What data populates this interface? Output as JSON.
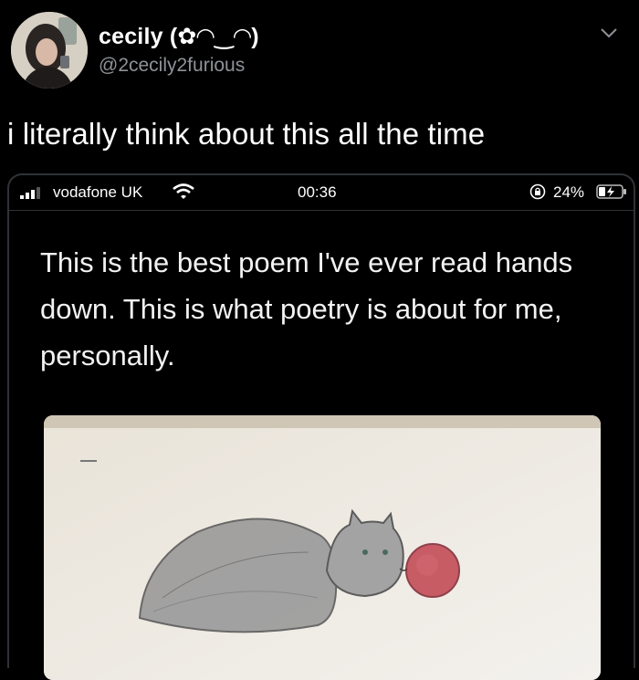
{
  "tweet": {
    "display_name": "cecily (✿◠‿◠)",
    "handle": "@2cecily2furious",
    "text": "i literally think about this all the time"
  },
  "screenshot": {
    "status_bar": {
      "carrier": "vodafone UK",
      "time": "00:36",
      "battery": "24%"
    },
    "post_text": "This is the best poem I've ever read hands down. This is what poetry is about for me, personally."
  },
  "icons": {
    "chevron": "chevron-down-icon",
    "signal": "signal-bars-icon",
    "wifi": "wifi-icon",
    "orientation_lock": "orientation-lock-icon",
    "battery": "battery-charging-icon"
  },
  "drawing": {
    "subject": "pencil drawing of a grey cat with a red ball"
  },
  "colors": {
    "background": "#000000",
    "handle": "#8e9297",
    "border": "#2f3236",
    "paper": "#efece6",
    "ball": "#c2434f"
  }
}
